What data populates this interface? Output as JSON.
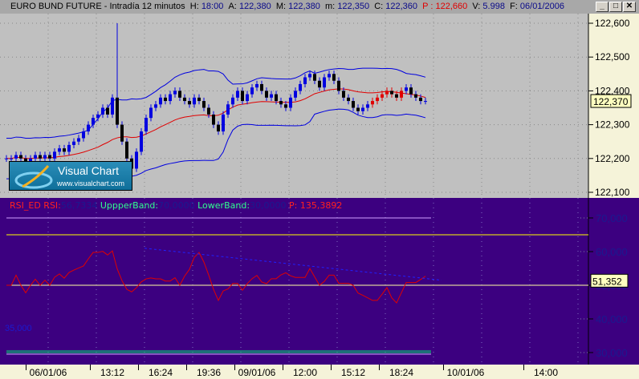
{
  "window": {
    "title": "EURO BUND FUTURE - Intradía 12 minutos",
    "h_label": "H:",
    "h": "18:00",
    "a_label": "A:",
    "a": "122,380",
    "m_label": "M:",
    "m": "122,380",
    "min_label": "m:",
    "min": "122,350",
    "c_label": "C:",
    "c": "122,360",
    "p": "P : 122,660",
    "v_label": "V:",
    "v": "5.998",
    "f_label": "F:",
    "f": "06/01/2006",
    "btn_min": "_",
    "btn_max": "□",
    "btn_close": "✕"
  },
  "logo": {
    "name": "Visual Chart",
    "url": "www.visualchart.com"
  },
  "rsi_header": {
    "name": "RSI_ED",
    "rsi_label": "RSI:",
    "rsi": "56,7334",
    "upper_label": "UppperBand:",
    "upper": "70,0000",
    "lower_label": "LowerBand:",
    "lower": "30,0000",
    "p": "P: 135,3892"
  },
  "rsi_current": "51,352",
  "rsi_left_label": "35,000",
  "colors": {
    "price_bg": "#c0c0c0",
    "rsi_bg": "#3c0080",
    "candle": "#0000e0",
    "ma": "#e00000",
    "band": "#0000e0",
    "rsi": "#e00000",
    "upper": "#ffff00",
    "lower": "#00e070"
  },
  "chart_data": [
    {
      "type": "candlestick",
      "title": "EURO BUND FUTURE - Intradía 12 minutos",
      "current_label": "122,370",
      "yticks": [
        "122,600",
        "122,500",
        "122,400",
        "122,300",
        "122,200",
        "122,100"
      ],
      "ytick_values": [
        122.6,
        122.5,
        122.4,
        122.3,
        122.2,
        122.1
      ],
      "ylim": [
        122.075,
        122.625
      ],
      "close": [
        122.2,
        122.2,
        122.21,
        122.2,
        122.19,
        122.2,
        122.21,
        122.2,
        122.21,
        122.2,
        122.22,
        122.23,
        122.22,
        122.24,
        122.25,
        122.26,
        122.28,
        122.3,
        122.32,
        122.33,
        122.35,
        122.33,
        122.38,
        122.3,
        122.25,
        122.2,
        122.17,
        122.22,
        122.28,
        122.32,
        122.35,
        122.36,
        122.38,
        122.37,
        122.39,
        122.4,
        122.38,
        122.37,
        122.36,
        122.38,
        122.37,
        122.35,
        122.33,
        122.3,
        122.28,
        122.33,
        122.36,
        122.38,
        122.4,
        122.37,
        122.39,
        122.41,
        122.42,
        122.4,
        122.38,
        122.39,
        122.37,
        122.36,
        122.35,
        122.38,
        122.4,
        122.42,
        122.44,
        122.45,
        122.43,
        122.41,
        122.44,
        122.45,
        122.43,
        122.4,
        122.38,
        122.37,
        122.35,
        122.34,
        122.35,
        122.36,
        122.37,
        122.38,
        122.39,
        122.4,
        122.39,
        122.38,
        122.4,
        122.41,
        122.39,
        122.38,
        122.37,
        122.37
      ],
      "spike_index": 23,
      "spike_high": 122.6
    },
    {
      "type": "line",
      "title": "RSI_ED",
      "yticks": [
        "70,000",
        "60,000",
        "50,000",
        "40,000",
        "30,000"
      ],
      "ytick_values": [
        70,
        60,
        50,
        40,
        30
      ],
      "ylim": [
        27,
        73
      ],
      "upper_band": 65,
      "lower_band": 35,
      "extra_levels": [
        50
      ],
      "top_level": 70,
      "bottom_level": 30
    }
  ],
  "xaxis": {
    "labels": [
      "06/01/06",
      "13:12",
      "16:24",
      "19:36",
      "09/01/06",
      "12:00",
      "15:12",
      "18:24",
      "10/01/06",
      "14:00"
    ]
  }
}
